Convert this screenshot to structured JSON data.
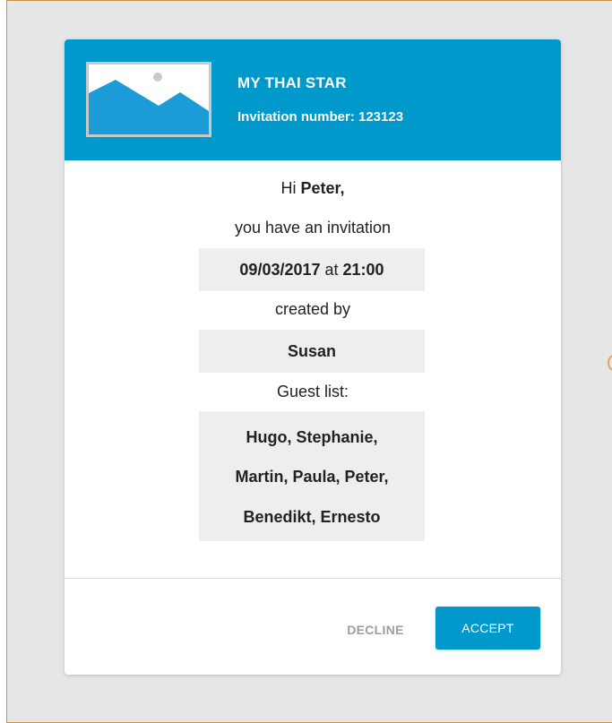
{
  "header": {
    "title": "MY THAI STAR",
    "invitation_label": "Invitation number: 123123"
  },
  "greeting": {
    "prefix": "Hi ",
    "name": "Peter,"
  },
  "invitation_text": "you have an invitation",
  "date_time": {
    "date": "09/03/2017",
    "at": " at ",
    "time": "21:00"
  },
  "created_by_label": "created by",
  "creator": "Susan",
  "guest_list_label": "Guest list:",
  "guests": {
    "line1": "Hugo, Stephanie,",
    "line2": "Martin, Paula, Peter,",
    "line3": "Benedikt, Ernesto"
  },
  "actions": {
    "decline_label": "DECLINE",
    "accept_label": "ACCEPT"
  },
  "colors": {
    "accent": "#0099cc",
    "panel_background": "#eeeeee",
    "page_background": "#e6e6e6"
  },
  "icons": {
    "thumbnail": "image-placeholder-icon"
  }
}
